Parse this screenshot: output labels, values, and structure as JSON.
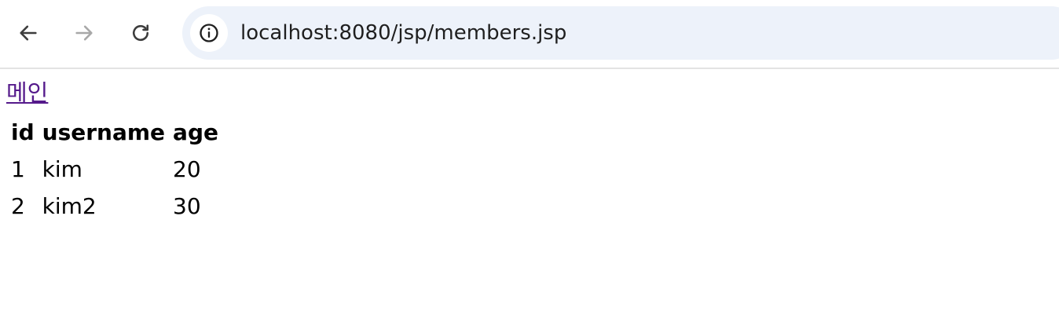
{
  "browser": {
    "back_icon": "arrow-left-icon",
    "forward_icon": "arrow-right-icon",
    "reload_icon": "reload-icon",
    "site_info_icon": "info-icon",
    "url": "localhost:8080/jsp/members.jsp"
  },
  "page": {
    "main_link": "메인",
    "table": {
      "headers": [
        "id",
        "username",
        "age"
      ],
      "rows": [
        [
          "1",
          "kim",
          "20"
        ],
        [
          "2",
          "kim2",
          "30"
        ]
      ]
    }
  },
  "colors": {
    "link_visited": "#551a8b",
    "omnibox_bg": "#edf2fa"
  }
}
